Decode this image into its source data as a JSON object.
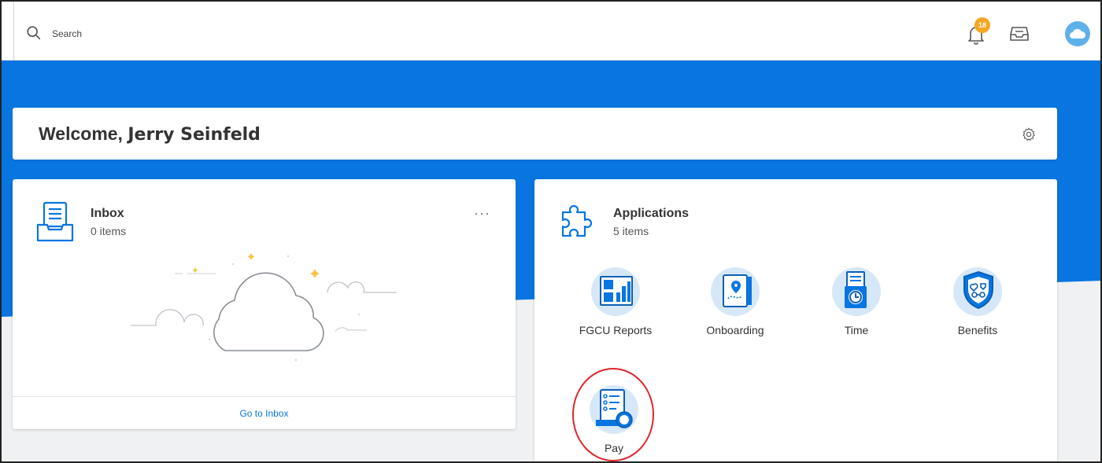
{
  "header": {
    "search_label": "Search",
    "notifications_count": "18"
  },
  "welcome": {
    "greeting": "Welcome,",
    "name": "Jerry Seinfeld"
  },
  "inbox": {
    "title": "Inbox",
    "count": "0 items",
    "more": "···",
    "footer_link": "Go to Inbox"
  },
  "applications": {
    "title": "Applications",
    "count": "5 items",
    "items": [
      {
        "label": "FGCU Reports",
        "icon": "reports-icon"
      },
      {
        "label": "Onboarding",
        "icon": "onboarding-icon"
      },
      {
        "label": "Time",
        "icon": "time-icon"
      },
      {
        "label": "Benefits",
        "icon": "benefits-icon"
      },
      {
        "label": "Pay",
        "icon": "pay-icon"
      }
    ]
  },
  "colors": {
    "brand_blue": "#0875e1",
    "badge": "#f5a623",
    "highlight_ring": "#e0262a"
  }
}
